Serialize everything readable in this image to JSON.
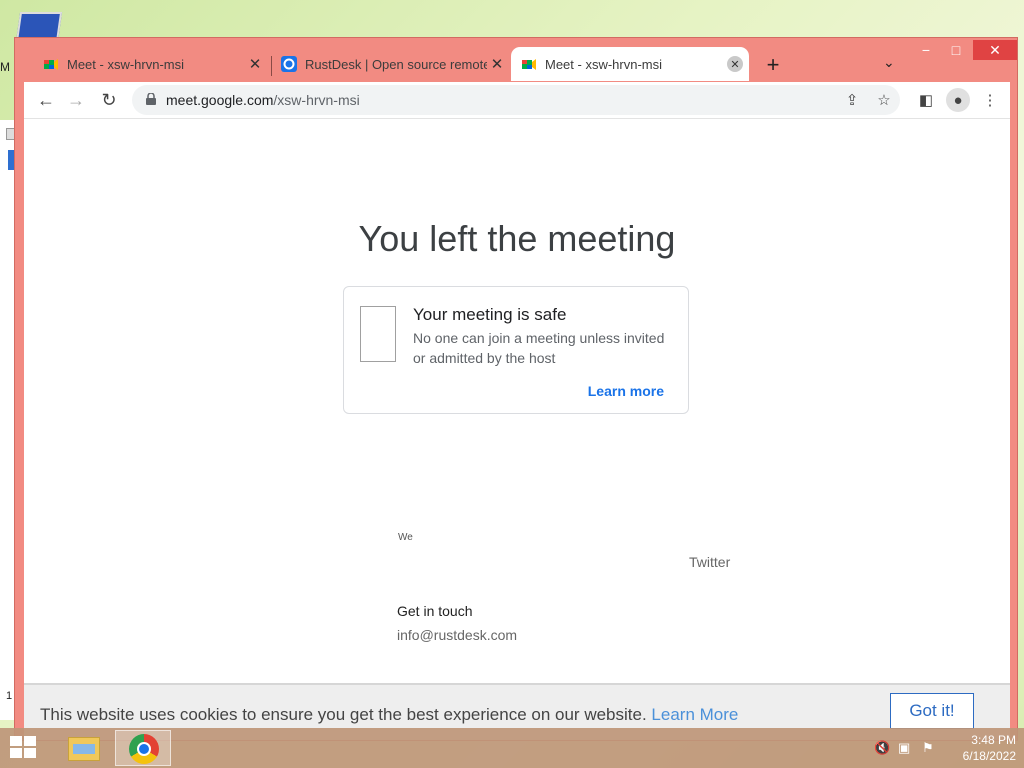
{
  "desktop": {
    "icon_label": "M",
    "under_window_number": "1"
  },
  "browser": {
    "tabs": [
      {
        "title": "Meet - xsw-hrvn-msi",
        "favicon": "google-meet-icon"
      },
      {
        "title": "RustDesk | Open source remote",
        "favicon": "rustdesk-icon"
      },
      {
        "title": "Meet - xsw-hrvn-msi",
        "favicon": "google-meet-icon"
      }
    ],
    "new_tab": "+",
    "window_buttons": {
      "minimize": "−",
      "maximize": "□",
      "close": "✕"
    }
  },
  "toolbar": {
    "url_host": "meet.google.com",
    "url_path": "/xsw-hrvn-msi"
  },
  "page": {
    "heading": "You left the meeting",
    "card": {
      "title": "Your meeting is safe",
      "description": "No one can join a meeting unless invited or admitted by the host",
      "link": "Learn more"
    },
    "fragment": "We",
    "twitter": "Twitter",
    "get_in_touch": "Get in touch",
    "email": "info@rustdesk.com",
    "cookie": {
      "message": "This website uses cookies to ensure you get the best experience on our website.",
      "learn_more": "Learn More",
      "button": "Got it!"
    }
  },
  "taskbar": {
    "time": "3:48 PM",
    "date": "6/18/2022"
  },
  "colors": {
    "frame": "#f28b82",
    "link": "#1a73e8",
    "cookie_button": "#2d6bc2"
  }
}
